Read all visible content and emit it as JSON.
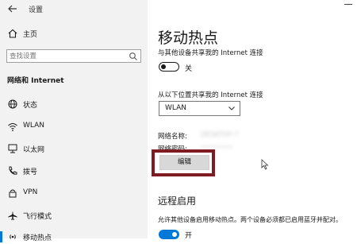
{
  "window": {
    "title": "设置"
  },
  "sidebar": {
    "home_label": "主页",
    "search_placeholder": "查找设置",
    "section_title": "网络和 Internet",
    "items": [
      {
        "label": "状态",
        "icon": "globe-icon"
      },
      {
        "label": "WLAN",
        "icon": "wifi-icon"
      },
      {
        "label": "以太网",
        "icon": "ethernet-icon"
      },
      {
        "label": "拨号",
        "icon": "phone-icon"
      },
      {
        "label": "VPN",
        "icon": "vpn-icon"
      },
      {
        "label": "飞行模式",
        "icon": "airplane-icon"
      },
      {
        "label": "移动热点",
        "icon": "hotspot-icon",
        "active": true
      }
    ]
  },
  "main": {
    "title": "移动热点",
    "share_label": "与其他设备共享我的 Internet 连接",
    "share_toggle": {
      "state": "关",
      "on": false
    },
    "share_from_label": "从以下位置共享我的 Internet 连接",
    "share_from_value": "WLAN",
    "network_name_label": "网络名称:",
    "network_name_value": "DESKTOP-7",
    "network_password_label": "网络密码:",
    "network_password_value": "••••••••",
    "edit_button": "编辑",
    "remote_title": "远程启用",
    "remote_desc": "允许其他设备启用移动热点。两个设备必须都已启用蓝牙并配对。",
    "remote_toggle": {
      "state": "开",
      "on": true
    }
  },
  "colors": {
    "accent": "#0078d7",
    "highlight": "#7f1b23",
    "sidebar_bg": "#f2f2f2"
  }
}
